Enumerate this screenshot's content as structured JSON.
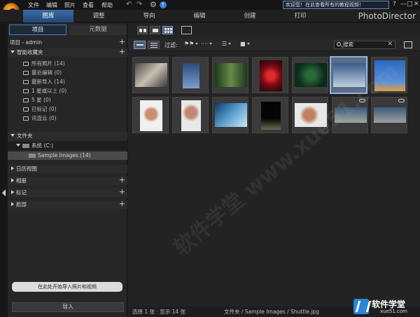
{
  "menubar": {
    "items": [
      "文件",
      "编辑",
      "照片",
      "查看",
      "帮助"
    ],
    "welcome_text": "欢迎您！在此查看所有的教程视频！",
    "window_buttons": [
      "?",
      "—",
      "□",
      "✕"
    ]
  },
  "tabs": [
    "图库",
    "调整",
    "导向",
    "编辑",
    "创建",
    "打印"
  ],
  "brand": "PhotoDirector",
  "panel": {
    "tab_project": "项目",
    "tab_metadata": "元数据",
    "project_header": "项目 - admin",
    "smart_collections": "智能收藏夹",
    "smart_items": [
      {
        "label": "所有照片 (14)",
        "color": "#d6d6d6"
      },
      {
        "label": "最近编辑 (0)",
        "color": "#d6d6d6"
      },
      {
        "label": "最新导入 (14)",
        "color": "#d6d6d6"
      },
      {
        "label": "1 星或以上 (0)",
        "color": "#d6d6d6"
      },
      {
        "label": "5 星 (0)",
        "color": "#d6d6d6"
      },
      {
        "label": "已标记 (0)",
        "color": "#d6d6d6"
      },
      {
        "label": "讯连云 (0)",
        "color": "#d6d6d6"
      }
    ],
    "folders": "文件夹",
    "drive": "系统 (C:)",
    "sample_folder": "Sample Images (14)",
    "calendar": "日历视图",
    "albums": "相册",
    "tags": "标记",
    "faces": "脸部",
    "hint": "在此处开始导入照片和视频",
    "import_label": "导入"
  },
  "toolbar": {
    "filter_label": "过滤:",
    "search_placeholder": "搜索"
  },
  "status": {
    "selection": "选择 1 张 · 显示 14 张",
    "path": "文件夹 / Sample Images / Shuttle.jpg"
  },
  "thumbnails": [
    {
      "colors": [
        "#5a5a5a",
        "#c8c0b0"
      ]
    },
    {
      "colors": [
        "#2a4a7a",
        "#7aa0d0"
      ]
    },
    {
      "colors": [
        "#1a3a1a",
        "#6a8a4a"
      ]
    },
    {
      "colors": [
        "#7a0a14",
        "#e02a2a"
      ]
    },
    {
      "colors": [
        "#0a2a1a",
        "#2a6a3a"
      ]
    },
    {
      "colors": [
        "#1a0a14",
        "#b02050"
      ]
    },
    {
      "colors": [
        "#3a5a8a",
        "#c0d0e0"
      ]
    },
    {
      "colors": [
        "#2a6ac0",
        "#e0a040"
      ]
    },
    {
      "colors": [
        "#f0f0f0",
        "#c89070"
      ]
    },
    {
      "colors": [
        "#e8e8e8",
        "#c08870"
      ]
    },
    {
      "colors": [
        "#0a3a6a",
        "#5aa0d0"
      ]
    },
    {
      "colors": [
        "#050505",
        "#6a6a50"
      ]
    },
    {
      "colors": [
        "#e8e8e8",
        "#c08060"
      ]
    },
    {
      "colors": [
        "#3a5a7a",
        "#a0a8a0"
      ]
    },
    {
      "colors": [
        "#3a5a7a",
        "#a0a0a0"
      ]
    }
  ],
  "watermark": "软件学堂 www.xue51.com",
  "corner_brand": {
    "title": "软件学堂",
    "sub": "xue51.com"
  }
}
